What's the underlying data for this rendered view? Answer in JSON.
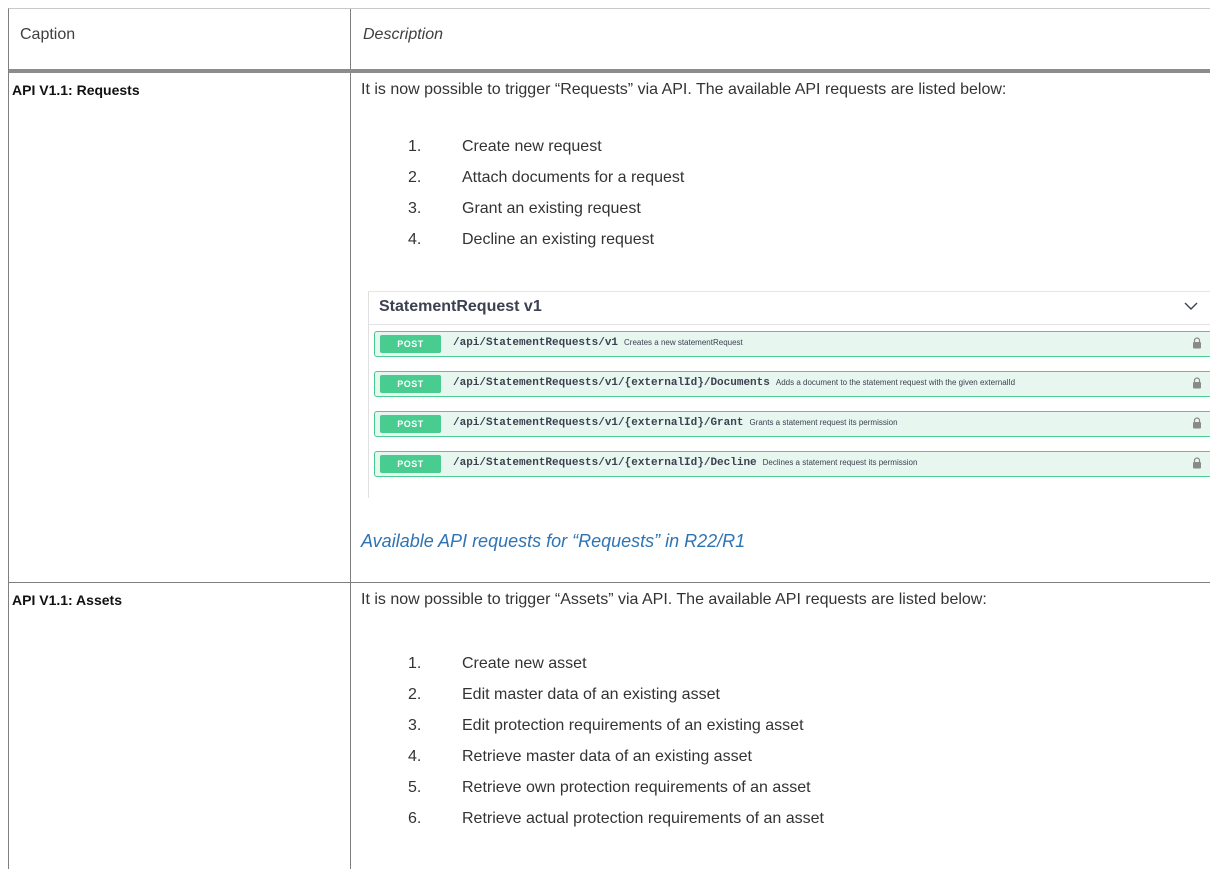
{
  "header": {
    "caption": "Caption",
    "description": "Description"
  },
  "requests": {
    "title": "API V1.1: Requests",
    "intro": "It is now possible to trigger “Requests” via API. The available API requests are listed below:",
    "items": [
      {
        "num": "1.",
        "text": "Create new request"
      },
      {
        "num": "2.",
        "text": "Attach documents for a request"
      },
      {
        "num": "3.",
        "text": "Grant an existing request"
      },
      {
        "num": "4.",
        "text": "Decline an existing request"
      }
    ],
    "swagger": {
      "title": "StatementRequest v1",
      "operations": [
        {
          "method": "POST",
          "path": "/api/StatementRequests/v1",
          "description": "Creates a new statementRequest"
        },
        {
          "method": "POST",
          "path": "/api/StatementRequests/v1/{externalId}/Documents",
          "description": "Adds a document to the statement request with the given externalId"
        },
        {
          "method": "POST",
          "path": "/api/StatementRequests/v1/{externalId}/Grant",
          "description": "Grants a statement request its permission"
        },
        {
          "method": "POST",
          "path": "/api/StatementRequests/v1/{externalId}/Decline",
          "description": "Declines a statement request its permission"
        }
      ]
    },
    "caption": "Available API requests for “Requests” in R22/R1"
  },
  "assets": {
    "title": "API V1.1: Assets",
    "intro": "It is now possible to trigger “Assets” via API. The available API requests are listed below:",
    "items": [
      {
        "num": "1.",
        "text": "Create new asset"
      },
      {
        "num": "2.",
        "text": "Edit master data of an existing asset"
      },
      {
        "num": "3.",
        "text": "Edit protection requirements of an existing asset"
      },
      {
        "num": "4.",
        "text": "Retrieve master data of an existing asset"
      },
      {
        "num": "5.",
        "text": "Retrieve own protection requirements of an asset"
      },
      {
        "num": "6.",
        "text": "Retrieve actual protection requirements of an asset"
      }
    ]
  },
  "colors": {
    "post_green": "#49cc90",
    "op_bg": "#e8f6f0",
    "caption_blue": "#2e74b5"
  }
}
